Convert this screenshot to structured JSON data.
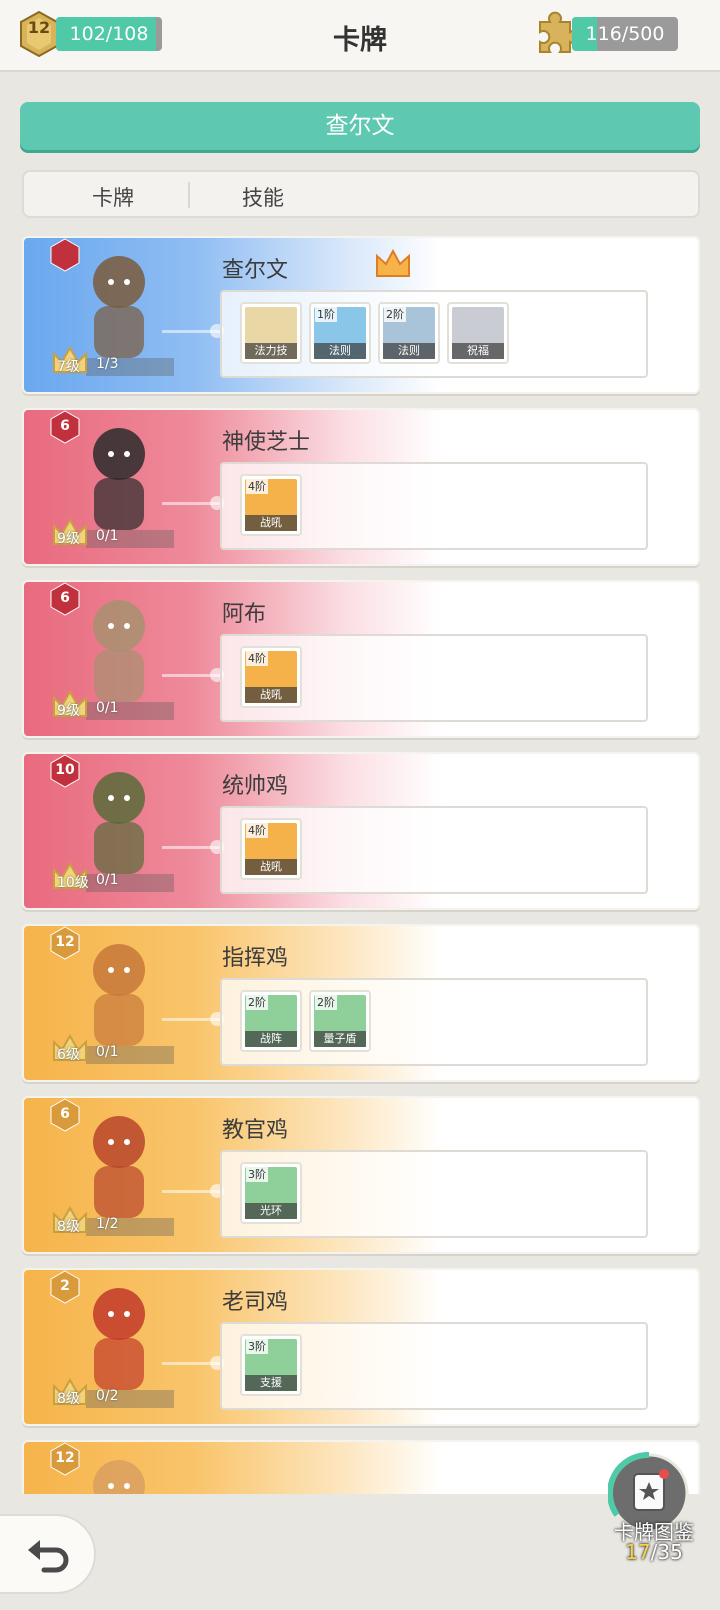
{
  "header": {
    "title": "卡牌",
    "player_level": "12",
    "exp_text": "102/108",
    "exp_fraction": 0.944,
    "fragments_text": "116/500",
    "fragments_fraction": 0.232
  },
  "hero_button": {
    "label": "查尔文"
  },
  "tabs": [
    {
      "label": "卡牌"
    },
    {
      "label": "技能"
    }
  ],
  "colors": {
    "accent": "#5ec9b0",
    "blue_card": "#6aa8ef",
    "red_card": "#e96a7e",
    "orange_card": "#f6b44b"
  },
  "cards": [
    {
      "name": "查尔文",
      "star": "",
      "level": "7级",
      "count": "1/3",
      "crown": true,
      "skills": [
        {
          "tier": "",
          "name": "法力技"
        },
        {
          "tier": "1阶",
          "name": "法则"
        },
        {
          "tier": "2阶",
          "name": "法则"
        },
        {
          "tier": "",
          "name": "祝福"
        }
      ]
    },
    {
      "name": "神使芝士",
      "star": "6",
      "level": "9级",
      "count": "0/1",
      "skills": [
        {
          "tier": "4阶",
          "name": "战吼"
        }
      ]
    },
    {
      "name": "阿布",
      "star": "6",
      "level": "9级",
      "count": "0/1",
      "skills": [
        {
          "tier": "4阶",
          "name": "战吼"
        }
      ]
    },
    {
      "name": "统帅鸡",
      "star": "10",
      "level": "10级",
      "count": "0/1",
      "skills": [
        {
          "tier": "4阶",
          "name": "战吼"
        }
      ]
    },
    {
      "name": "指挥鸡",
      "star": "12",
      "level": "6级",
      "count": "0/1",
      "skills": [
        {
          "tier": "2阶",
          "name": "战阵"
        },
        {
          "tier": "2阶",
          "name": "量子盾"
        }
      ]
    },
    {
      "name": "教官鸡",
      "star": "6",
      "level": "8级",
      "count": "1/2",
      "skills": [
        {
          "tier": "3阶",
          "name": "光环"
        }
      ]
    },
    {
      "name": "老司鸡",
      "star": "2",
      "level": "8级",
      "count": "0/2",
      "skills": [
        {
          "tier": "3阶",
          "name": "支援"
        }
      ]
    },
    {
      "name": "",
      "star": "12",
      "level": "",
      "count": "",
      "skills": []
    }
  ],
  "collection": {
    "label": "卡牌图鉴",
    "owned": "17",
    "total": "/35"
  }
}
